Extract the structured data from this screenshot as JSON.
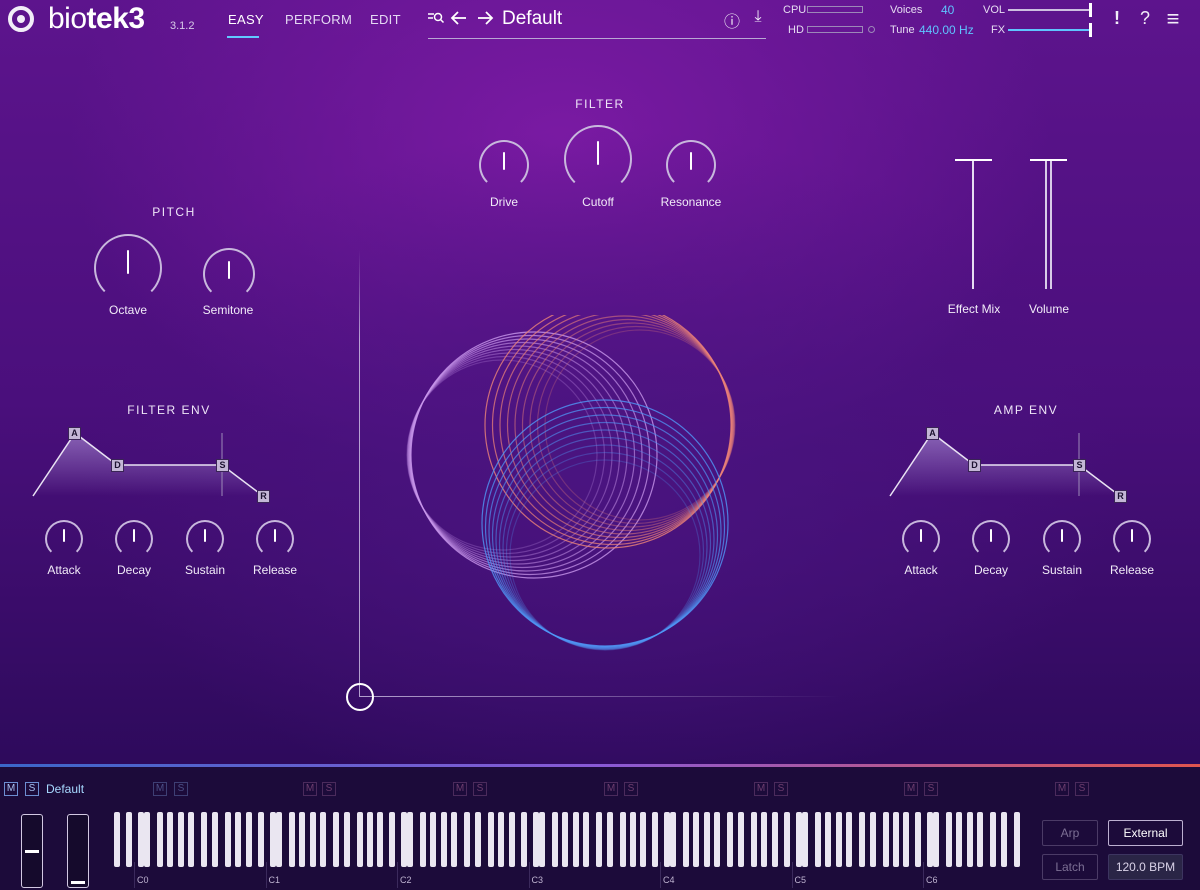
{
  "app": {
    "name_light": "bio",
    "name_bold": "tek3",
    "version": "3.1.2"
  },
  "nav": {
    "tabs": [
      "EASY",
      "PERFORM",
      "EDIT"
    ],
    "active": "EASY"
  },
  "preset": {
    "name": "Default"
  },
  "status": {
    "cpu_label": "CPU",
    "hd_label": "HD",
    "voices_label": "Voices",
    "voices_value": "40",
    "tune_label": "Tune",
    "tune_value": "440.00 Hz",
    "vol_label": "VOL",
    "fx_label": "FX",
    "vol_level": 0.98,
    "fx_level": 0.98
  },
  "header_icons": {
    "info": "ⓘ",
    "download": "⤓",
    "alert": "!",
    "help": "?",
    "menu": "≡"
  },
  "filter": {
    "title": "FILTER",
    "knobs": [
      "Drive",
      "Cutoff",
      "Resonance"
    ]
  },
  "pitch": {
    "title": "PITCH",
    "knobs": [
      "Octave",
      "Semitone"
    ]
  },
  "mix": {
    "sliders": [
      "Effect Mix",
      "Volume"
    ]
  },
  "filter_env": {
    "title": "FILTER ENV",
    "nodes": [
      "A",
      "D",
      "S",
      "R"
    ],
    "knobs": [
      "Attack",
      "Decay",
      "Sustain",
      "Release"
    ]
  },
  "amp_env": {
    "title": "AMP ENV",
    "nodes": [
      "A",
      "D",
      "S",
      "R"
    ],
    "knobs": [
      "Attack",
      "Decay",
      "Sustain",
      "Release"
    ]
  },
  "layer": {
    "mute": "M",
    "solo": "S",
    "name": "Default"
  },
  "keyboard": {
    "octaves": [
      "C0",
      "C1",
      "C2",
      "C3",
      "C4",
      "C5",
      "C6"
    ]
  },
  "controls": {
    "arp": "Arp",
    "external": "External",
    "latch": "Latch",
    "bpm": "120.0 BPM"
  }
}
